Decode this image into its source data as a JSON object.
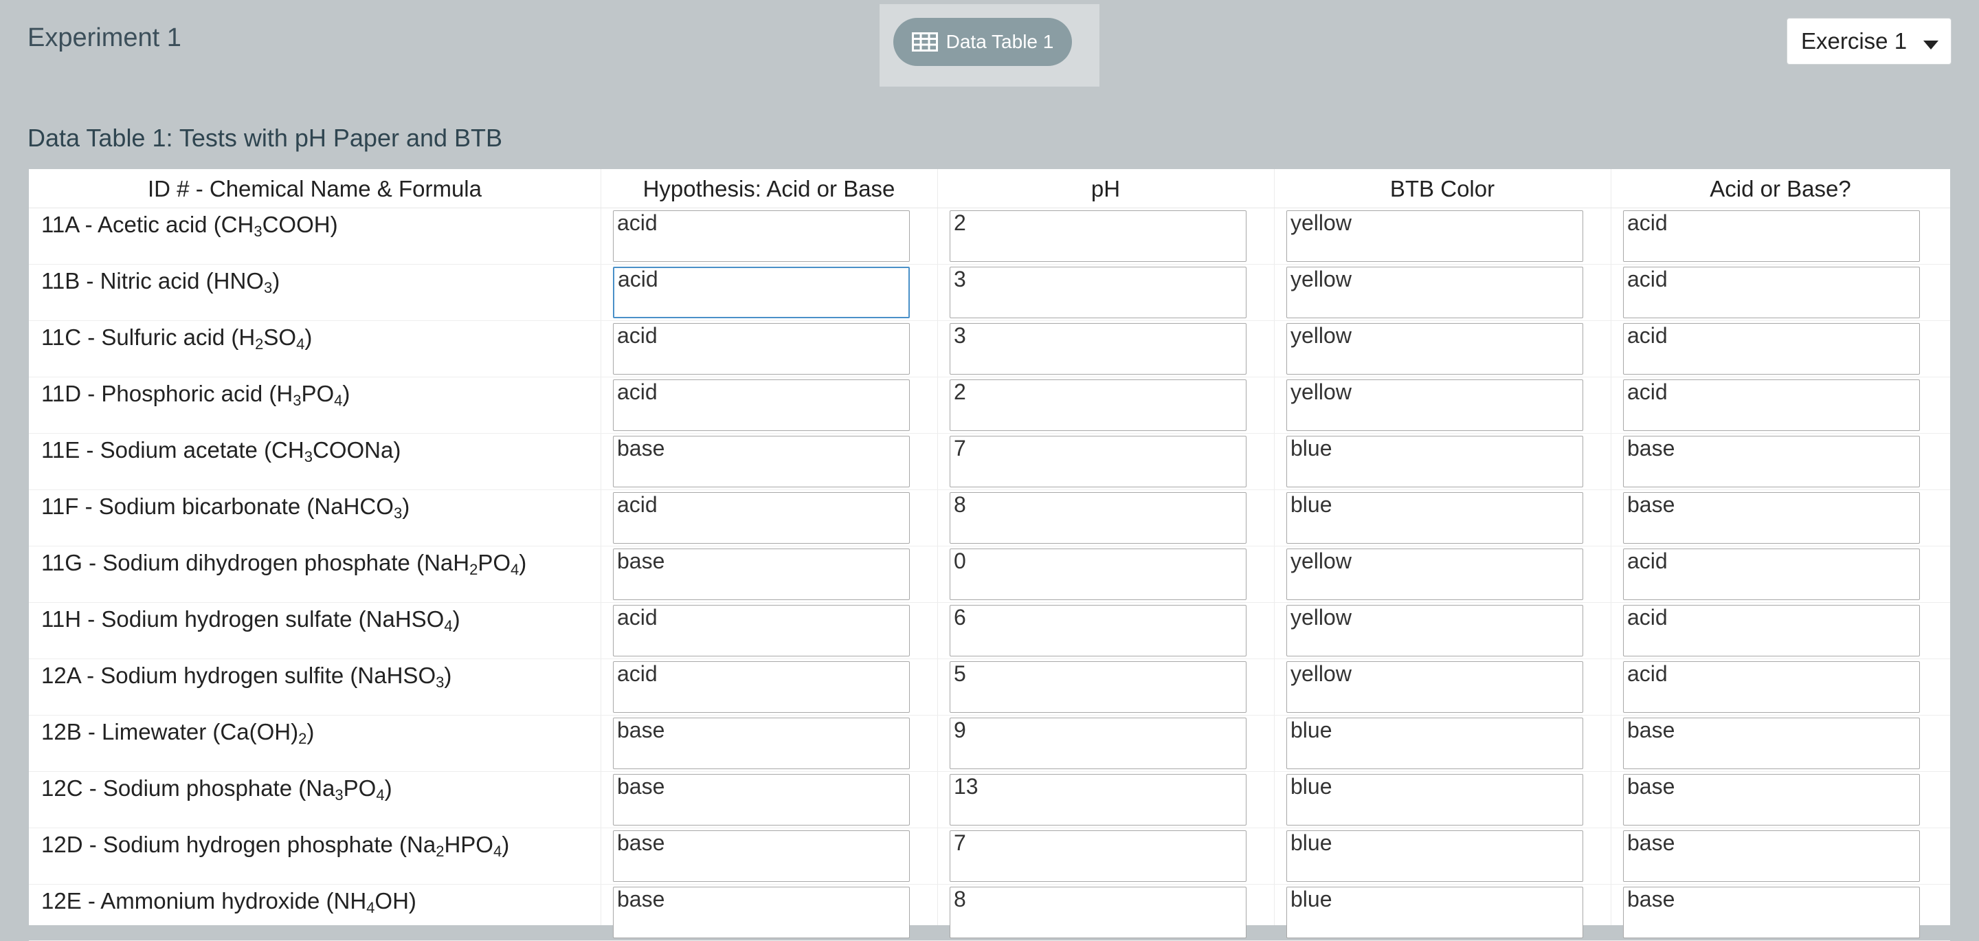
{
  "header": {
    "experiment_title": "Experiment 1",
    "tab_label": "Data Table 1",
    "exercise_select": "Exercise 1"
  },
  "table": {
    "title": "Data Table 1: Tests with pH Paper and BTB",
    "columns": [
      "ID # - Chemical Name & Formula",
      "Hypothesis: Acid or Base",
      "pH",
      "BTB Color",
      "Acid or Base?"
    ],
    "rows": [
      {
        "name": "11A - Acetic acid (CH<sub>3</sub>COOH)",
        "hypothesis": "acid",
        "ph": "2",
        "btb": "yellow",
        "result": "acid"
      },
      {
        "name": "11B - Nitric acid (HNO<sub>3</sub>)",
        "hypothesis": "acid",
        "ph": "3",
        "btb": "yellow",
        "result": "acid"
      },
      {
        "name": "11C - Sulfuric acid (H<sub>2</sub>SO<sub>4</sub>)",
        "hypothesis": "acid",
        "ph": "3",
        "btb": "yellow",
        "result": "acid"
      },
      {
        "name": "11D - Phosphoric acid (H<sub>3</sub>PO<sub>4</sub>)",
        "hypothesis": "acid",
        "ph": "2",
        "btb": "yellow",
        "result": "acid"
      },
      {
        "name": "11E - Sodium acetate (CH<sub>3</sub>COONa)",
        "hypothesis": "base",
        "ph": "7",
        "btb": "blue",
        "result": "base"
      },
      {
        "name": "11F - Sodium bicarbonate (NaHCO<sub>3</sub>)",
        "hypothesis": "acid",
        "ph": "8",
        "btb": "blue",
        "result": "base"
      },
      {
        "name": "11G - Sodium dihydrogen phosphate (NaH<sub>2</sub>PO<sub>4</sub>)",
        "hypothesis": "base",
        "ph": "0",
        "btb": "yellow",
        "result": "acid"
      },
      {
        "name": "11H - Sodium hydrogen sulfate (NaHSO<sub>4</sub>)",
        "hypothesis": "acid",
        "ph": "6",
        "btb": "yellow",
        "result": "acid"
      },
      {
        "name": "12A - Sodium hydrogen sulfite (NaHSO<sub>3</sub>)",
        "hypothesis": "acid",
        "ph": "5",
        "btb": "yellow",
        "result": "acid"
      },
      {
        "name": "12B - Limewater (Ca(OH)<sub>2</sub>)",
        "hypothesis": "base",
        "ph": "9",
        "btb": "blue",
        "result": "base"
      },
      {
        "name": "12C - Sodium phosphate (Na<sub>3</sub>PO<sub>4</sub>)",
        "hypothesis": "base",
        "ph": "13",
        "btb": "blue",
        "result": "base"
      },
      {
        "name": "12D - Sodium hydrogen phosphate (Na<sub>2</sub>HPO<sub>4</sub>)",
        "hypothesis": "base",
        "ph": "7",
        "btb": "blue",
        "result": "base"
      },
      {
        "name": "12E - Ammonium hydroxide (NH<sub>4</sub>OH)",
        "hypothesis": "base",
        "ph": "8",
        "btb": "blue",
        "result": "base"
      }
    ]
  },
  "colors": {
    "background": "#c0c6c9",
    "tab_pill": "#8a9da3",
    "title_text": "#2f4550",
    "focus_border": "#4a90c8"
  },
  "icons": {
    "tab_icon": "table-icon",
    "select_icon": "caret-down-icon"
  }
}
